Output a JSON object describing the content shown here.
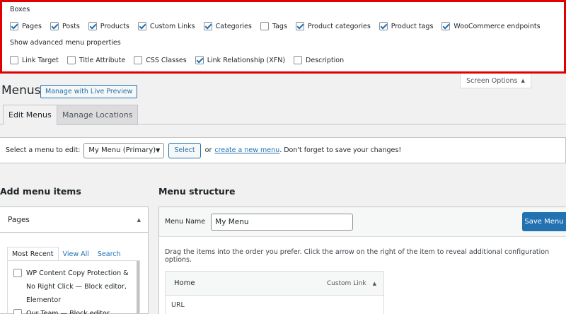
{
  "screen_options": {
    "boxes_legend": "Boxes",
    "boxes": [
      {
        "label": "Pages",
        "checked": true
      },
      {
        "label": "Posts",
        "checked": true
      },
      {
        "label": "Products",
        "checked": true
      },
      {
        "label": "Custom Links",
        "checked": true
      },
      {
        "label": "Categories",
        "checked": true
      },
      {
        "label": "Tags",
        "checked": false
      },
      {
        "label": "Product categories",
        "checked": true
      },
      {
        "label": "Product tags",
        "checked": true
      },
      {
        "label": "WooCommerce endpoints",
        "checked": true
      }
    ],
    "advanced_legend": "Show advanced menu properties",
    "advanced": [
      {
        "label": "Link Target",
        "checked": false
      },
      {
        "label": "Title Attribute",
        "checked": false
      },
      {
        "label": "CSS Classes",
        "checked": false
      },
      {
        "label": "Link Relationship (XFN)",
        "checked": true
      },
      {
        "label": "Description",
        "checked": false
      }
    ],
    "tab_label": "Screen Options",
    "highlight_color": "#e00000"
  },
  "header": {
    "title": "Menus",
    "live_preview_label": "Manage with Live Preview"
  },
  "tabs": [
    {
      "label": "Edit Menus",
      "active": true
    },
    {
      "label": "Manage Locations",
      "active": false
    }
  ],
  "select_bar": {
    "label": "Select a menu to edit:",
    "selected_menu": "My Menu (Primary)",
    "select_button": "Select",
    "or_text": "or",
    "create_link": "create a new menu",
    "rest_text": ". Don't forget to save your changes!"
  },
  "add_items": {
    "heading": "Add menu items",
    "box_title": "Pages",
    "subtabs": [
      "Most Recent",
      "View All",
      "Search"
    ],
    "pages": [
      {
        "label": "WP Content Copy Protection & No Right Click — Block editor, Elementor",
        "checked": false
      },
      {
        "label": "Our Team — Block editor,",
        "checked": false
      }
    ]
  },
  "structure": {
    "heading": "Menu structure",
    "menu_name_label": "Menu Name",
    "menu_name_value": "My Menu",
    "save_label": "Save Menu",
    "instructions": "Drag the items into the order you prefer. Click the arrow on the right of the item to reveal additional configuration options.",
    "items": [
      {
        "title": "Home",
        "type": "Custom Link",
        "field_label": "URL"
      }
    ],
    "accent_color": "#2271b1"
  }
}
